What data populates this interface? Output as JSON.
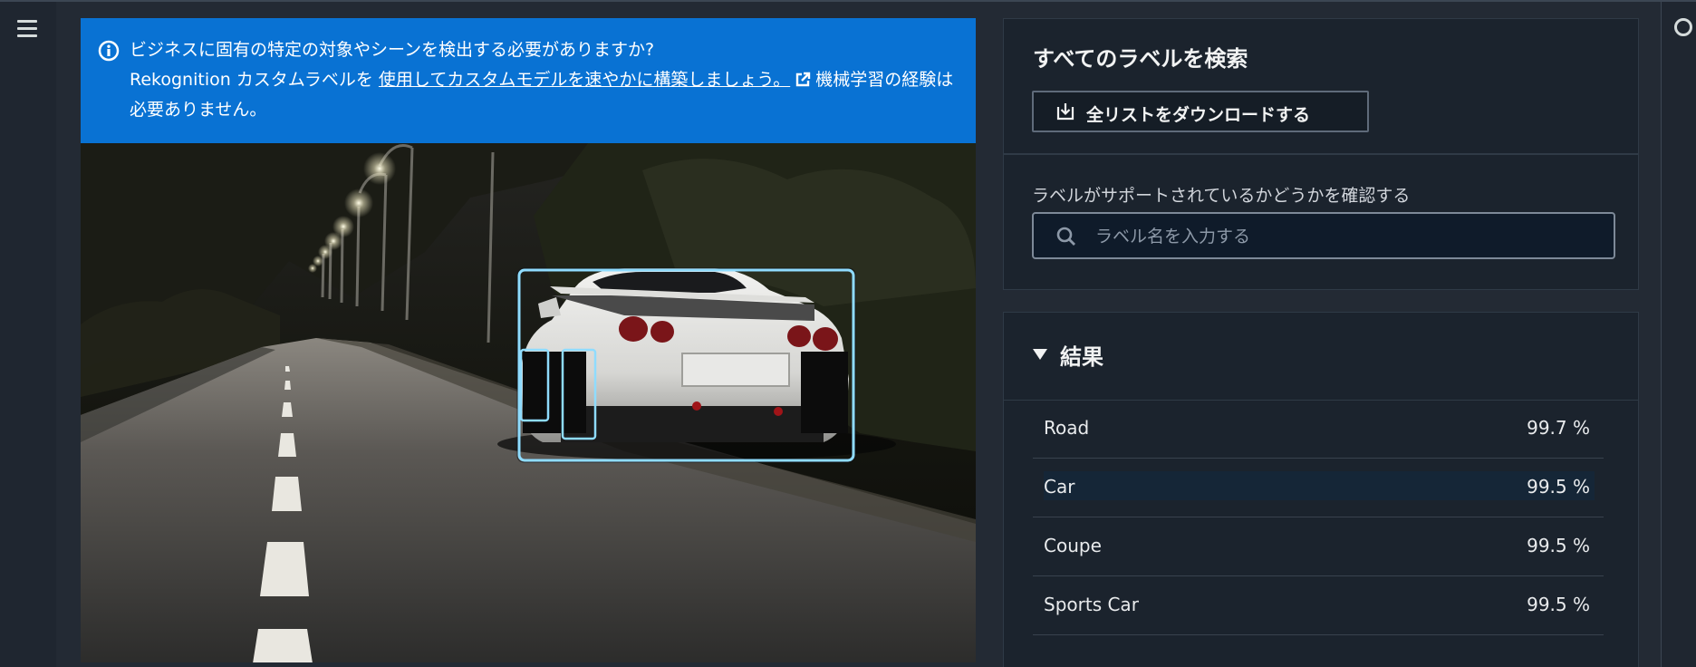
{
  "colors": {
    "notice_bg": "#0972d3",
    "panel_bg": "#1b232d",
    "page_bg": "#232a34",
    "selected_row": "#152637",
    "bounding_box": "#8fdcff"
  },
  "nav": {
    "menu_icon": "hamburger-menu-icon",
    "right_icon": "settings-icon"
  },
  "notice": {
    "line1": "ビジネスに固有の特定の対象やシーンを検出する必要がありますか?",
    "prefix": "Rekognition カスタムラベルを ",
    "link_text": "使用してカスタムモデルを速やかに構築しましょう。",
    "suffix": "機械学習の経験は必要ありません。",
    "info_icon": "info-icon",
    "external_icon": "external-link-icon"
  },
  "search_all": {
    "title": "すべてのラベルを検索",
    "download_label": "全リストをダウンロードする",
    "download_icon": "download-icon"
  },
  "label_check": {
    "label": "ラベルがサポートされているかどうかを確認する",
    "placeholder": "ラベル名を入力する",
    "search_icon": "search-icon"
  },
  "results": {
    "title": "結果",
    "items": [
      {
        "name": "Road",
        "confidence": "99.7 %"
      },
      {
        "name": "Car",
        "confidence": "99.5 %",
        "selected": true
      },
      {
        "name": "Coupe",
        "confidence": "99.5 %"
      },
      {
        "name": "Sports Car",
        "confidence": "99.5 %"
      }
    ]
  }
}
